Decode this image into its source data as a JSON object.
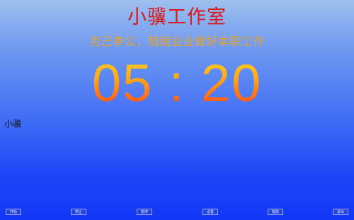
{
  "header": {
    "title": "小骥工作室",
    "motto": "克己奉公，兢兢业业做好本职工作"
  },
  "timer": {
    "display": "05 : 20"
  },
  "user": {
    "name": "小骥"
  },
  "controls": [
    {
      "label": "开始"
    },
    {
      "label": "停止"
    },
    {
      "label": "暂停"
    },
    {
      "label": "设置"
    },
    {
      "label": "帮助"
    },
    {
      "label": "退出"
    }
  ],
  "colors": {
    "title": "#d81a1a",
    "motto": "#e7a12a",
    "clock_top": "#ffdd22",
    "clock_bottom": "#ff3a14",
    "background_top": "#9ec0ee",
    "background_bottom": "#1238f8"
  }
}
